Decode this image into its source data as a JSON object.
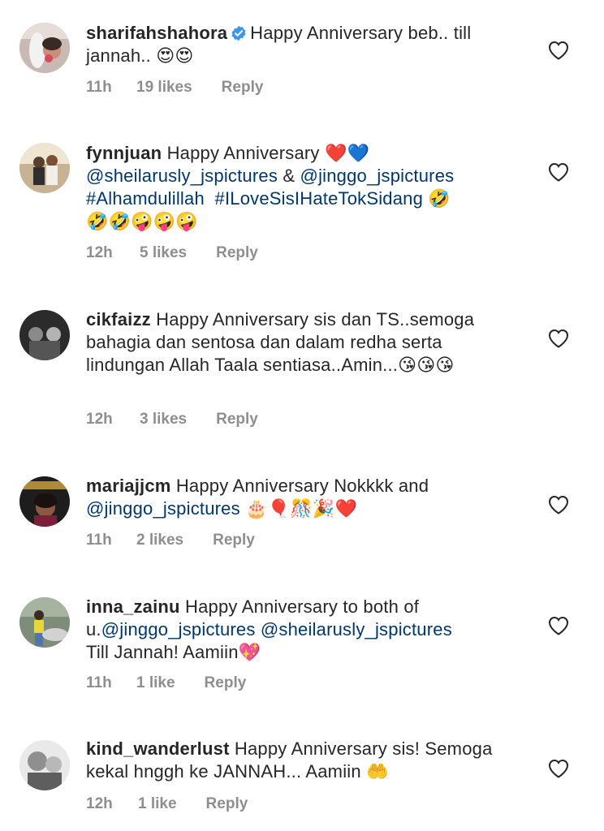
{
  "comments": [
    {
      "username": "sharifahshahora",
      "verified": true,
      "text": "Happy Anniversary beb.. till jannah.. 😍😍",
      "time": "11h",
      "likes": "19 likes",
      "reply": "Reply"
    },
    {
      "username": "fynnjuan",
      "text_1": "Happy Anniversary ❤️💙",
      "mention_1": "@sheilarusly_jspictures",
      "text_2": " & ",
      "mention_2": "@jinggo_jspictures",
      "mention_3": "#Alhamdulillah",
      "mention_4": "#ILoveSisIHateTokSidang",
      "text_3": " 🤣",
      "text_4": "🤣🤣🤪🤪🤪",
      "time": "12h",
      "likes": "5 likes",
      "reply": "Reply"
    },
    {
      "username": "cikfaizz",
      "text": "Happy Anniversary sis dan TS..semoga bahagia dan sentosa dan dalam redha serta lindungan Allah Taala sentiasa..Amin...😘😘😘",
      "time": "12h",
      "likes": "3 likes",
      "reply": "Reply"
    },
    {
      "username": "mariajjcm",
      "text_1": "Happy Anniversary Nokkkk and",
      "mention_1": "@jinggo_jspictures",
      "text_2": " 🎂🎈🎊🎉❤️",
      "time": "11h",
      "likes": "2 likes",
      "reply": "Reply"
    },
    {
      "username": "inna_zainu",
      "text_1": "Happy Anniversary to both of u.",
      "mention_1": "@jinggo_jspictures",
      "mention_2": "@sheilarusly_jspictures",
      "text_2": "Till Jannah!  Aamiin💖",
      "time": "11h",
      "likes": "1 like",
      "reply": "Reply"
    },
    {
      "username": "kind_wanderlust",
      "text": "Happy Anniversary sis! Semoga kekal hnggh ke JANNAH... Aamiin 🤲",
      "time": "12h",
      "likes": "1 like",
      "reply": "Reply"
    }
  ],
  "icons": {
    "heart": "heart-outline-icon",
    "verified": "verified-badge-icon"
  },
  "colors": {
    "text": "#262626",
    "meta": "#8e8e8e",
    "mention": "#00376b",
    "verified": "#3897f0"
  }
}
